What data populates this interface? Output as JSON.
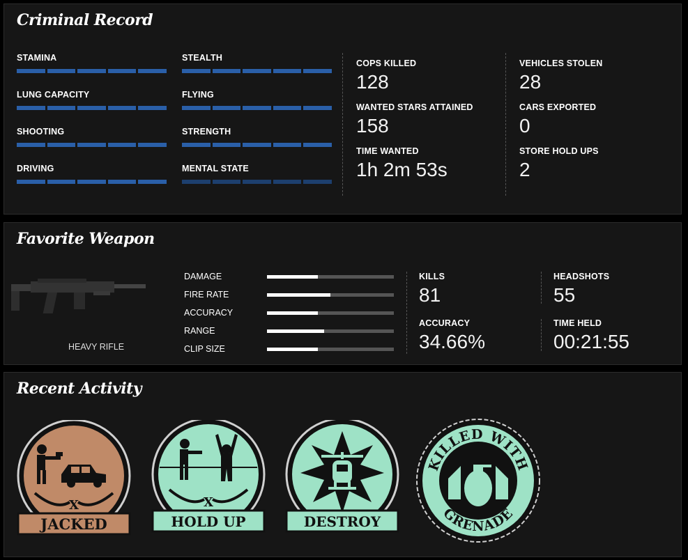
{
  "criminal": {
    "title": "Criminal Record",
    "skills": [
      {
        "label": "STAMINA",
        "level": 1.0
      },
      {
        "label": "STEALTH",
        "level": 1.0
      },
      {
        "label": "LUNG CAPACITY",
        "level": 1.0
      },
      {
        "label": "FLYING",
        "level": 1.0
      },
      {
        "label": "SHOOTING",
        "level": 1.0
      },
      {
        "label": "STRENGTH",
        "level": 1.0
      },
      {
        "label": "DRIVING",
        "level": 1.0
      },
      {
        "label": "MENTAL STATE",
        "level": 0.0
      }
    ],
    "stats": [
      {
        "label": "COPS KILLED",
        "value": "128"
      },
      {
        "label": "WANTED STARS ATTAINED",
        "value": "158"
      },
      {
        "label": "TIME WANTED",
        "value": "1h 2m 53s"
      },
      {
        "label": "VEHICLES STOLEN",
        "value": "28"
      },
      {
        "label": "CARS EXPORTED",
        "value": "0"
      },
      {
        "label": "STORE HOLD UPS",
        "value": "2"
      }
    ],
    "colors": {
      "bar": "#2a5fa8",
      "bar_dim": "#1d3f6e"
    }
  },
  "weapon": {
    "title": "Favorite Weapon",
    "name": "HEAVY RIFLE",
    "attributes": [
      {
        "label": "DAMAGE",
        "level": 0.4
      },
      {
        "label": "FIRE RATE",
        "level": 0.5
      },
      {
        "label": "ACCURACY",
        "level": 0.4
      },
      {
        "label": "RANGE",
        "level": 0.45
      },
      {
        "label": "CLIP SIZE",
        "level": 0.4
      }
    ],
    "stats": [
      {
        "label": "KILLS",
        "value": "81"
      },
      {
        "label": "HEADSHOTS",
        "value": "55"
      },
      {
        "label": "ACCURACY",
        "value": "34.66%"
      },
      {
        "label": "TIME HELD",
        "value": "00:21:55"
      }
    ]
  },
  "activity": {
    "title": "Recent Activity",
    "badges": [
      {
        "label": "JACKED",
        "color": "#c08a68",
        "icon": "carjack-icon"
      },
      {
        "label": "HOLD UP",
        "color": "#9ee2c6",
        "icon": "holdup-icon"
      },
      {
        "label": "DESTROY",
        "color": "#9ee2c6",
        "icon": "helicopter-icon"
      },
      {
        "label_top": "KILLED WITH",
        "label_bottom": "GRENADE",
        "color": "#9ee2c6",
        "icon": "grenade-icon"
      }
    ]
  }
}
